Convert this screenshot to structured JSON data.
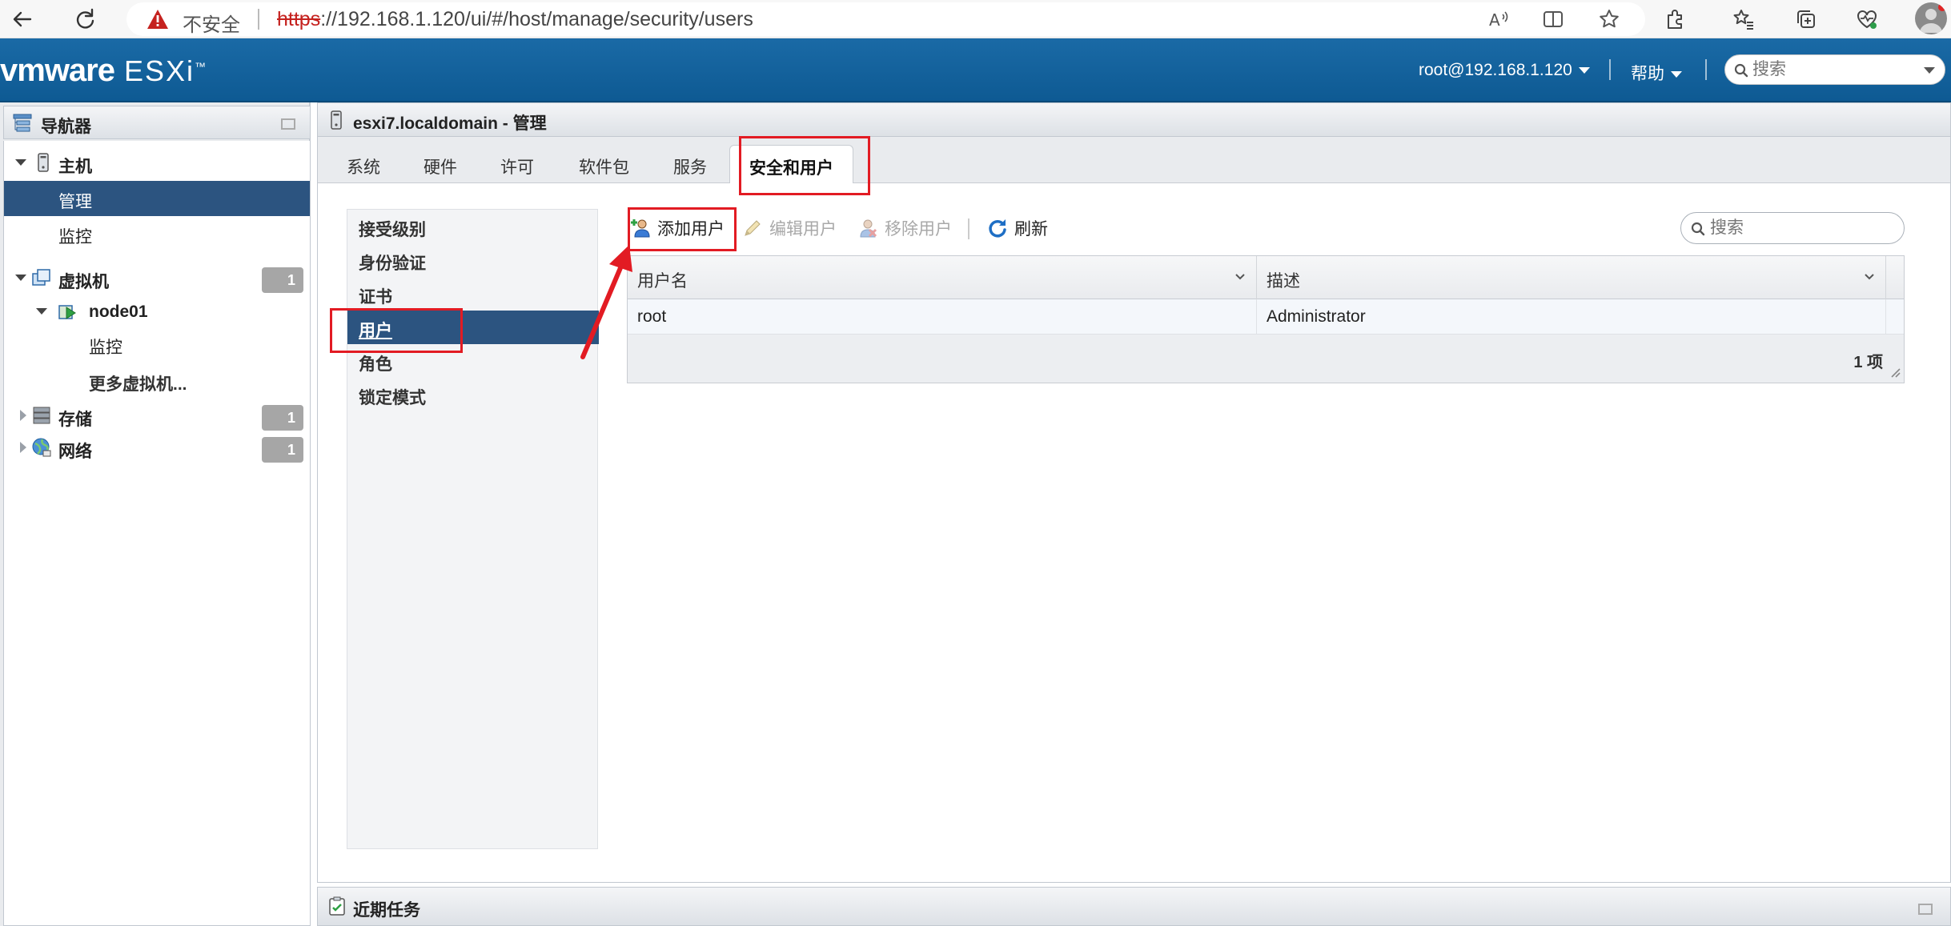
{
  "browser": {
    "security_warning": "不安全",
    "url_scheme": "https",
    "url_rest": "://192.168.1.120/ui/#/host/manage/security/users"
  },
  "header": {
    "logo_vm": "vmware",
    "logo_product": "ESXi",
    "logo_tm": "™",
    "user": "root@192.168.1.120",
    "help": "帮助",
    "search_placeholder": "搜索"
  },
  "navigator": {
    "title": "导航器",
    "host": "主机",
    "manage": "管理",
    "monitor": "监控",
    "vms": "虚拟机",
    "vms_count": "1",
    "vm_node": "node01",
    "vm_monitor": "监控",
    "more_vms": "更多虚拟机...",
    "storage": "存储",
    "storage_count": "1",
    "network": "网络",
    "network_count": "1"
  },
  "main": {
    "title": "esxi7.localdomain - 管理",
    "tabs": [
      "系统",
      "硬件",
      "许可",
      "软件包",
      "服务",
      "安全和用户"
    ],
    "security_menu": [
      "接受级别",
      "身份验证",
      "证书",
      "用户",
      "角色",
      "锁定模式"
    ],
    "toolbar": {
      "add_user": "添加用户",
      "edit_user": "编辑用户",
      "remove_user": "移除用户",
      "refresh": "刷新",
      "search_placeholder": "搜索"
    },
    "grid": {
      "columns": [
        "用户名",
        "描述"
      ],
      "rows": [
        {
          "username": "root",
          "description": "Administrator"
        }
      ],
      "count": "1 项"
    }
  },
  "recent_tasks": {
    "title": "近期任务"
  },
  "colors": {
    "header_blue": "#1a6aa6",
    "selected_row": "#2c5480",
    "annotation_red": "#e21b23",
    "badge_gray": "#a6a6a6"
  }
}
